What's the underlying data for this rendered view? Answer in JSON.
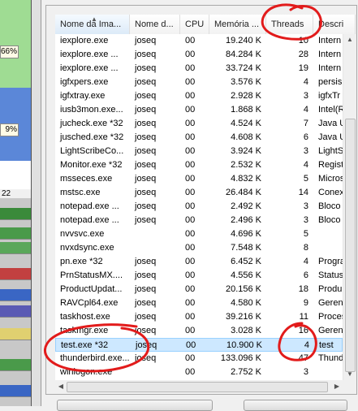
{
  "left_panel": {
    "percent_a": "66%",
    "percent_b": "9%",
    "number": "22"
  },
  "columns": {
    "name": "Nome da Ima...",
    "user": "Nome d...",
    "cpu": "CPU",
    "memory": "Memória ...",
    "threads": "Threads",
    "description": "Descri"
  },
  "processes": [
    {
      "name": "iexplore.exe",
      "user": "joseq",
      "cpu": "00",
      "memory": "19.240 K",
      "threads": "10",
      "description": "Intern"
    },
    {
      "name": "iexplore.exe ...",
      "user": "joseq",
      "cpu": "00",
      "memory": "84.284 K",
      "threads": "28",
      "description": "Intern"
    },
    {
      "name": "iexplore.exe ...",
      "user": "joseq",
      "cpu": "00",
      "memory": "33.724 K",
      "threads": "19",
      "description": "Intern"
    },
    {
      "name": "igfxpers.exe",
      "user": "joseq",
      "cpu": "00",
      "memory": "3.576 K",
      "threads": "4",
      "description": "persis"
    },
    {
      "name": "igfxtray.exe",
      "user": "joseq",
      "cpu": "00",
      "memory": "2.928 K",
      "threads": "3",
      "description": "igfxTr"
    },
    {
      "name": "iusb3mon.exe...",
      "user": "joseq",
      "cpu": "00",
      "memory": "1.868 K",
      "threads": "4",
      "description": "Intel(R"
    },
    {
      "name": "jucheck.exe *32",
      "user": "joseq",
      "cpu": "00",
      "memory": "4.524 K",
      "threads": "7",
      "description": "Java U"
    },
    {
      "name": "jusched.exe *32",
      "user": "joseq",
      "cpu": "00",
      "memory": "4.608 K",
      "threads": "6",
      "description": "Java U"
    },
    {
      "name": "LightScribeCo...",
      "user": "joseq",
      "cpu": "00",
      "memory": "3.924 K",
      "threads": "3",
      "description": "LightS"
    },
    {
      "name": "Monitor.exe *32",
      "user": "joseq",
      "cpu": "00",
      "memory": "2.532 K",
      "threads": "4",
      "description": "Regist"
    },
    {
      "name": "msseces.exe",
      "user": "joseq",
      "cpu": "00",
      "memory": "4.832 K",
      "threads": "5",
      "description": "Micros"
    },
    {
      "name": "mstsc.exe",
      "user": "joseq",
      "cpu": "00",
      "memory": "26.484 K",
      "threads": "14",
      "description": "Conex"
    },
    {
      "name": "notepad.exe ...",
      "user": "joseq",
      "cpu": "00",
      "memory": "2.492 K",
      "threads": "3",
      "description": "Bloco"
    },
    {
      "name": "notepad.exe ...",
      "user": "joseq",
      "cpu": "00",
      "memory": "2.496 K",
      "threads": "3",
      "description": "Bloco"
    },
    {
      "name": "nvvsvc.exe",
      "user": "",
      "cpu": "00",
      "memory": "4.696 K",
      "threads": "5",
      "description": ""
    },
    {
      "name": "nvxdsync.exe",
      "user": "",
      "cpu": "00",
      "memory": "7.548 K",
      "threads": "8",
      "description": ""
    },
    {
      "name": "pn.exe *32",
      "user": "joseq",
      "cpu": "00",
      "memory": "6.452 K",
      "threads": "4",
      "description": "Progra"
    },
    {
      "name": "PrnStatusMX....",
      "user": "joseq",
      "cpu": "00",
      "memory": "4.556 K",
      "threads": "6",
      "description": "Status"
    },
    {
      "name": "ProductUpdat...",
      "user": "joseq",
      "cpu": "00",
      "memory": "20.156 K",
      "threads": "18",
      "description": "Produ"
    },
    {
      "name": "RAVCpl64.exe",
      "user": "joseq",
      "cpu": "00",
      "memory": "4.580 K",
      "threads": "9",
      "description": "Geren"
    },
    {
      "name": "taskhost.exe",
      "user": "joseq",
      "cpu": "00",
      "memory": "39.216 K",
      "threads": "11",
      "description": "Proces"
    },
    {
      "name": "taskmgr.exe",
      "user": "joseq",
      "cpu": "00",
      "memory": "3.028 K",
      "threads": "16",
      "description": "Geren"
    },
    {
      "name": "test.exe *32",
      "user": "joseq",
      "cpu": "00",
      "memory": "10.900 K",
      "threads": "4",
      "description": "test"
    },
    {
      "name": "thunderbird.exe...",
      "user": "joseq",
      "cpu": "00",
      "memory": "133.096 K",
      "threads": "47",
      "description": "Thund"
    },
    {
      "name": "winlogon.exe",
      "user": "",
      "cpu": "00",
      "memory": "2.752 K",
      "threads": "3",
      "description": ""
    }
  ],
  "selected_process": "test.exe *32",
  "annotation_color": "#e21b1b",
  "selection_color": "#cde8ff"
}
